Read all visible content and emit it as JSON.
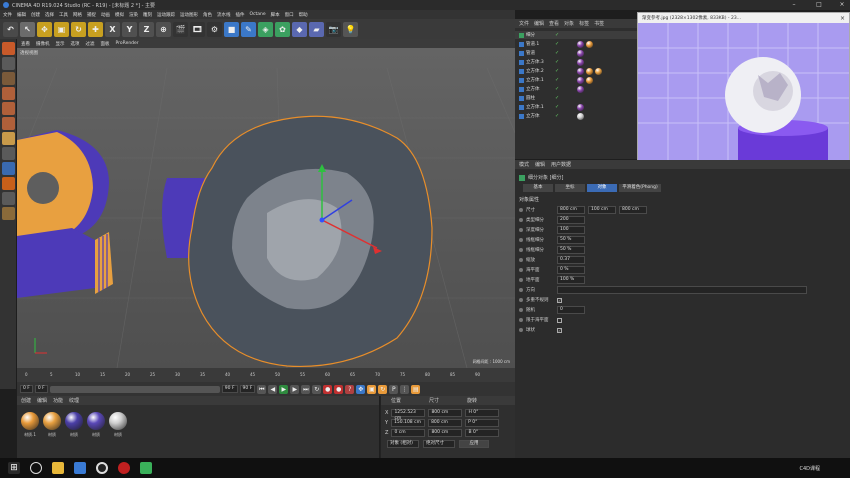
{
  "window": {
    "title": "CINEMA 4D R19.024 Studio (RC - R19) - [未标题 2 *] - 主要"
  },
  "menus": [
    "文件",
    "编辑",
    "创建",
    "选择",
    "工具",
    "网格",
    "捕捉",
    "动画",
    "模拟",
    "渲染",
    "雕刻",
    "运动跟踪",
    "运动图形",
    "角色",
    "流水线",
    "插件",
    "Octane",
    "脚本",
    "窗口",
    "帮助"
  ],
  "toolbar": {
    "buttons": [
      "X",
      "Y",
      "Z"
    ]
  },
  "viewport": {
    "menu": [
      "查看",
      "摄像机",
      "显示",
      "选项",
      "过滤",
      "面板",
      "ProRender"
    ],
    "label": "透视视图",
    "grid_text": "网格间距 : 1000 cm"
  },
  "timeline": {
    "ticks": [
      "0",
      "5",
      "10",
      "15",
      "20",
      "25",
      "30",
      "35",
      "40",
      "45",
      "50",
      "55",
      "60",
      "65",
      "70",
      "75",
      "80",
      "85",
      "90"
    ],
    "end_label": "0 F"
  },
  "transport": {
    "start": "0 F",
    "current": "0 F",
    "end": "90 F",
    "end2": "90 F"
  },
  "materials": {
    "menu": [
      "创建",
      "编辑",
      "功能",
      "纹理"
    ],
    "items": [
      {
        "label": "材质.1",
        "color": "#e89a3a"
      },
      {
        "label": "材质",
        "color": "#e8a040"
      },
      {
        "label": "材质",
        "color": "#4b3fa8"
      },
      {
        "label": "材质",
        "color": "#5a48b8"
      },
      {
        "label": "材质",
        "color": "#cfcfcf"
      }
    ]
  },
  "coords": {
    "headers": [
      "位置",
      "尺寸",
      "旋转"
    ],
    "rows": [
      {
        "axis": "X",
        "pos": "1252.523 cm",
        "size": "800 cm",
        "rot": "H 0°"
      },
      {
        "axis": "Y",
        "pos": "150.108 cm",
        "size": "800 cm",
        "rot": "P 0°"
      },
      {
        "axis": "Z",
        "pos": "0 cm",
        "size": "800 cm",
        "rot": "B 0°"
      }
    ],
    "mode": "对象 (相对)",
    "size_mode": "绝对尺寸",
    "apply": "应用"
  },
  "objects": {
    "menu": [
      "文件",
      "编辑",
      "查看",
      "对象",
      "标签",
      "书签"
    ],
    "rows": [
      {
        "name": "细分",
        "balls": []
      },
      {
        "name": "管道.1",
        "balls": [
          "#8844aa",
          "#e89a3a"
        ]
      },
      {
        "name": "管道",
        "balls": [
          "#8844aa"
        ]
      },
      {
        "name": "立方体.3",
        "balls": [
          "#8844aa"
        ]
      },
      {
        "name": "立方体.2",
        "balls": [
          "#8844aa",
          "#e89a3a",
          "#e8a040"
        ]
      },
      {
        "name": "立方体.1",
        "balls": [
          "#8844aa",
          "#e89a3a"
        ]
      },
      {
        "name": "立方体",
        "balls": [
          "#8844aa"
        ]
      },
      {
        "name": "圆柱",
        "balls": []
      },
      {
        "name": "立方体.1",
        "balls": [
          "#8844aa"
        ]
      },
      {
        "name": "立方体",
        "balls": [
          "#cfcfcf"
        ]
      }
    ]
  },
  "image_window": {
    "title": "渐变参考.jpg (2328×1302像素, 833KB) - 23..."
  },
  "attributes": {
    "menu": [
      "模式",
      "编辑",
      "用户数据"
    ],
    "object_name": "细分对象 [细分]",
    "tabs": [
      "基本",
      "坐标",
      "对象",
      "平滑着色(Phong)"
    ],
    "section": "对象属性",
    "props": [
      {
        "label": "尺寸",
        "value": "800 cm",
        "v2": "100 cm",
        "v3": "800 cm"
      },
      {
        "label": "类型细分",
        "value": "200"
      },
      {
        "label": "深度细分",
        "value": "100"
      },
      {
        "label": "线框细分",
        "value": "50 %"
      },
      {
        "label": "线框细分",
        "value": "50 %"
      },
      {
        "label": "缩放",
        "value": "0.37"
      },
      {
        "label": "海平面",
        "value": "0 %"
      },
      {
        "label": "地平面",
        "value": "100 %"
      },
      {
        "label": "方向",
        "value": ""
      },
      {
        "label": "多重不规则",
        "value": "✓"
      },
      {
        "label": "随机",
        "value": "0"
      },
      {
        "label": "限于海平面",
        "value": ""
      },
      {
        "label": "球状",
        "value": "✓"
      }
    ]
  },
  "taskbar": {
    "clock": "C4D课程"
  }
}
